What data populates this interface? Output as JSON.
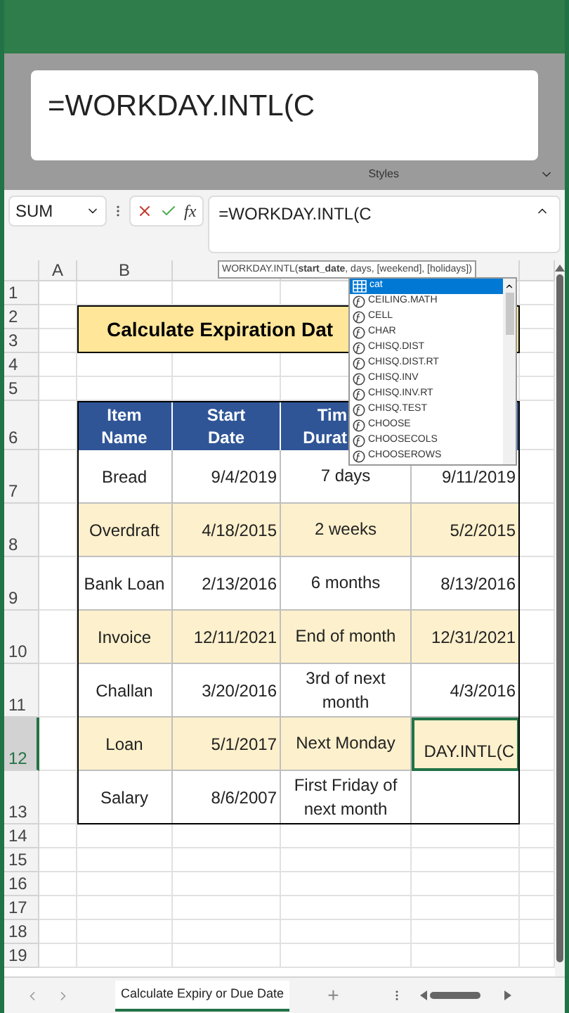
{
  "ribbon": {
    "group_label": "Styles"
  },
  "formula_popup": {
    "text": "=WORKDAY.INTL(C"
  },
  "name_box": {
    "value": "SUM"
  },
  "formula_bar": {
    "fx_label": "fx",
    "value": "=WORKDAY.INTL(C"
  },
  "column_headers": [
    "A",
    "B"
  ],
  "function_tooltip": {
    "text": "WORKDAY.INTL(**start_date**, days, [weekend], [holidays])"
  },
  "autocomplete": {
    "items": [
      {
        "label": "cat",
        "kind": "table",
        "selected": true
      },
      {
        "label": "CEILING.MATH",
        "kind": "function",
        "selected": false
      },
      {
        "label": "CELL",
        "kind": "function",
        "selected": false
      },
      {
        "label": "CHAR",
        "kind": "function",
        "selected": false
      },
      {
        "label": "CHISQ.DIST",
        "kind": "function",
        "selected": false
      },
      {
        "label": "CHISQ.DIST.RT",
        "kind": "function",
        "selected": false
      },
      {
        "label": "CHISQ.INV",
        "kind": "function",
        "selected": false
      },
      {
        "label": "CHISQ.INV.RT",
        "kind": "function",
        "selected": false
      },
      {
        "label": "CHISQ.TEST",
        "kind": "function",
        "selected": false
      },
      {
        "label": "CHOOSE",
        "kind": "function",
        "selected": false
      },
      {
        "label": "CHOOSECOLS",
        "kind": "function",
        "selected": false
      },
      {
        "label": "CHOOSEROWS",
        "kind": "function",
        "selected": false
      }
    ]
  },
  "row_numbers": [
    "1",
    "2",
    "3",
    "4",
    "5",
    "6",
    "7",
    "8",
    "9",
    "10",
    "11",
    "12",
    "13",
    "14",
    "15",
    "16",
    "17",
    "18",
    "19"
  ],
  "title": "Calculate Expiration Dat",
  "table": {
    "header": {
      "item": [
        "Item",
        "Name"
      ],
      "start": [
        "Start",
        "Date"
      ],
      "duration": [
        "Tim",
        "Durat"
      ]
    },
    "rows": [
      {
        "item": "Bread",
        "start": "9/4/2019",
        "duration": "7 days",
        "result": "9/11/2019",
        "striped": false,
        "selected": false
      },
      {
        "item": "Overdraft",
        "start": "4/18/2015",
        "duration": "2 weeks",
        "result": "5/2/2015",
        "striped": true,
        "selected": false
      },
      {
        "item": "Bank Loan",
        "start": "2/13/2016",
        "duration": "6 months",
        "result": "8/13/2016",
        "striped": false,
        "selected": false
      },
      {
        "item": "Invoice",
        "start": "12/11/2021",
        "duration": "End of month",
        "result": "12/31/2021",
        "striped": true,
        "selected": false
      },
      {
        "item": "Challan",
        "start": "3/20/2016",
        "duration": "3rd of next month",
        "result": "4/3/2016",
        "striped": false,
        "selected": false
      },
      {
        "item": "Loan",
        "start": "5/1/2017",
        "duration": "Next Monday",
        "result": "DAY.INTL(C",
        "striped": true,
        "selected": true
      },
      {
        "item": "Salary",
        "start": "8/6/2007",
        "duration": "First Friday of next month",
        "striped": false,
        "selected": false
      }
    ]
  },
  "sheet_tabs": [
    {
      "label": "Calculate Expiry or Due Date",
      "selected": true
    }
  ],
  "add_sheet": "+"
}
